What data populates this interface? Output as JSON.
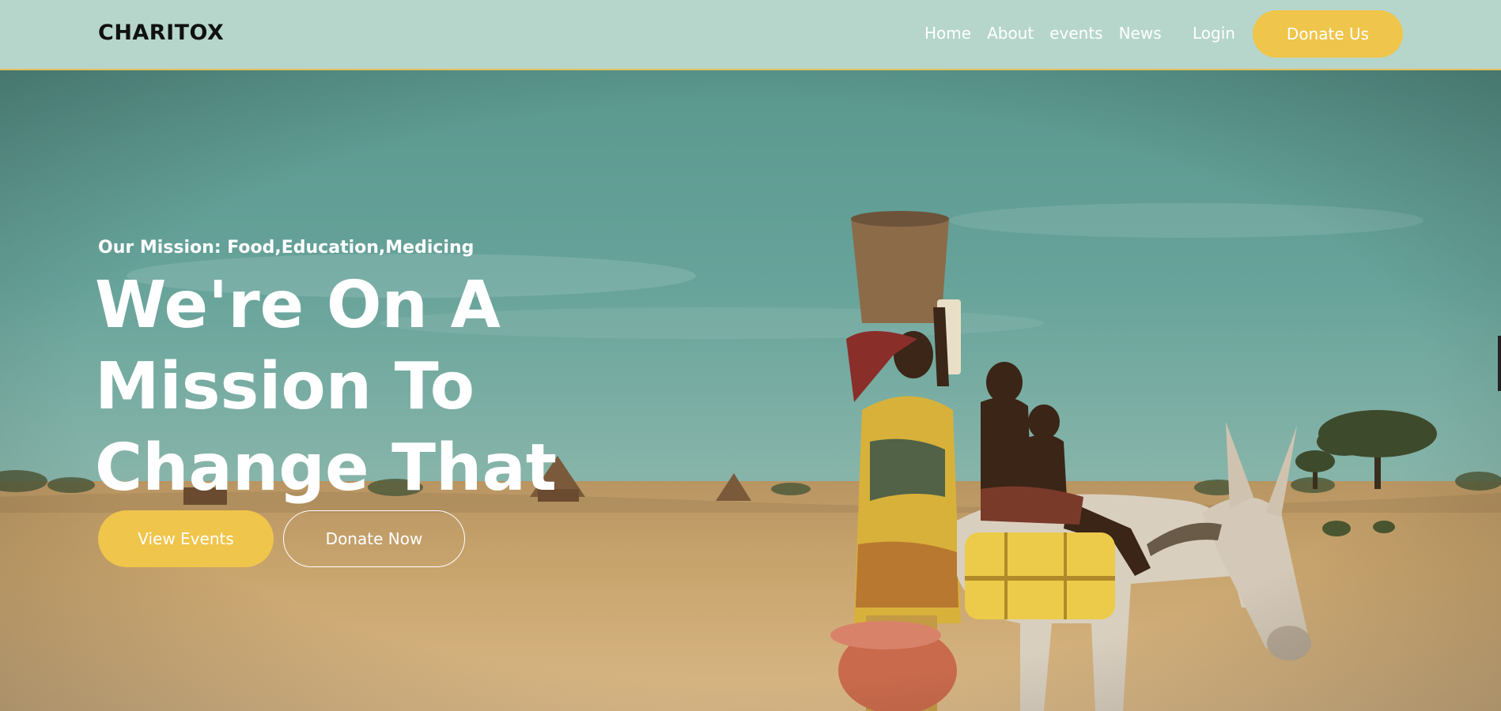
{
  "brand": {
    "logo_text": "CHARITOX"
  },
  "nav": {
    "items": [
      {
        "label": "Home"
      },
      {
        "label": "About"
      },
      {
        "label": "events"
      },
      {
        "label": "News"
      }
    ],
    "login_label": "Login",
    "donate_label": "Donate Us"
  },
  "hero": {
    "subtitle": "Our Mission: Food,Education,Medicing",
    "title_lines": [
      "We're On A",
      "Mission To",
      "Change That"
    ],
    "primary_button": "View Events",
    "secondary_button": "Donate Now"
  },
  "colors": {
    "nav_bg": "#b6d6cc",
    "accent": "#efc54b",
    "sky": "#5f9c92",
    "ground": "#c9a56e"
  }
}
